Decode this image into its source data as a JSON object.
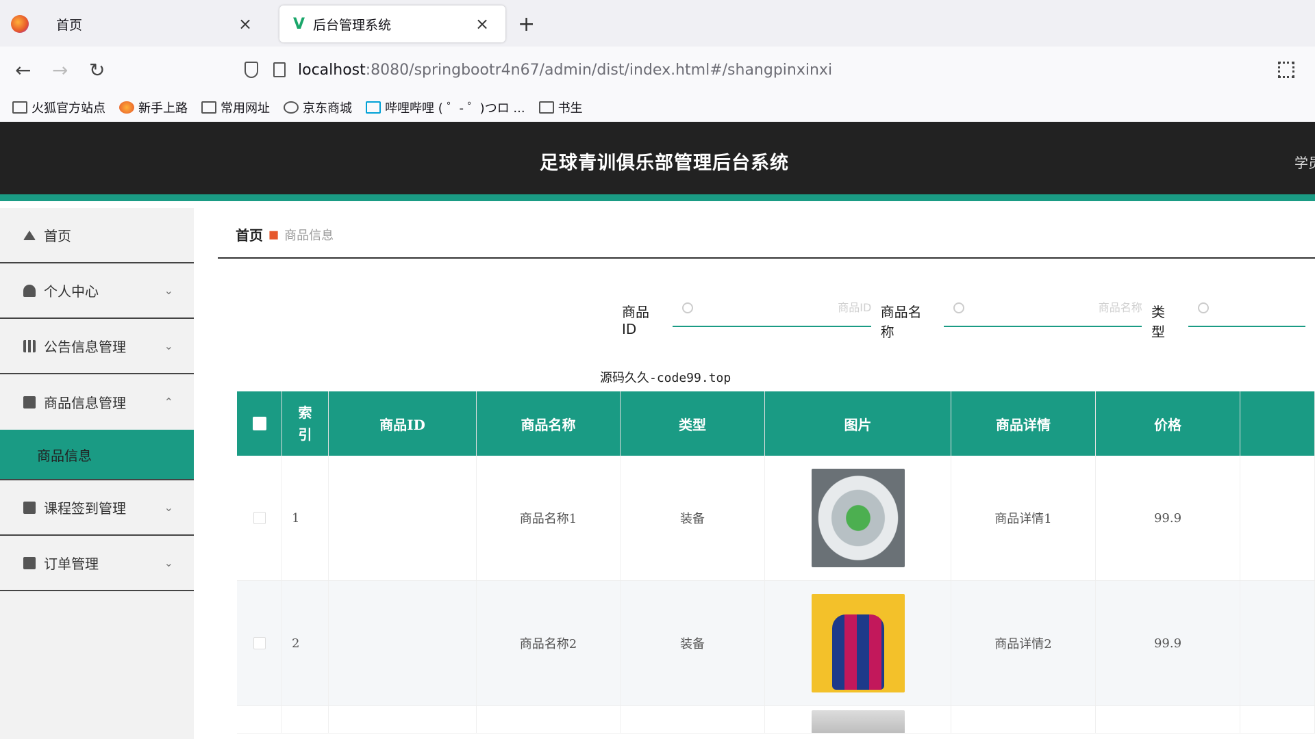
{
  "browser": {
    "tabs": [
      {
        "title": "首页",
        "close": "×"
      },
      {
        "title": "后台管理系统",
        "favicon": "V",
        "close": "×"
      }
    ],
    "new_tab": "+",
    "nav": {
      "back": "←",
      "forward": "→",
      "reload": "↻"
    },
    "url_host": "localhost",
    "url_rest": ":8080/springbootr4n67/admin/dist/index.html#/shangpinxinxi",
    "bookmarks": [
      "火狐官方站点",
      "新手上路",
      "常用网址",
      "京东商城",
      "哔哩哔哩 ( ゜- ゜)つロ ...",
      "书生"
    ]
  },
  "header": {
    "title": "足球青训俱乐部管理后台系统",
    "user": "学员"
  },
  "sidebar": {
    "items": [
      {
        "label": "首页",
        "chevron": ""
      },
      {
        "label": "个人中心",
        "chevron": "⌄"
      },
      {
        "label": "公告信息管理",
        "chevron": "⌄"
      },
      {
        "label": "商品信息管理",
        "chevron": "⌃"
      },
      {
        "label": "课程签到管理",
        "chevron": "⌄"
      },
      {
        "label": "订单管理",
        "chevron": "⌄"
      }
    ],
    "active_sub": "商品信息"
  },
  "breadcrumb": {
    "home": "首页",
    "current": "商品信息"
  },
  "search": {
    "fields": [
      {
        "label": "商品ID",
        "placeholder": "商品ID"
      },
      {
        "label": "商品名称",
        "placeholder": "商品名称"
      },
      {
        "label": "类型",
        "placeholder": ""
      }
    ]
  },
  "source_note": "源码久久-code99.top",
  "table": {
    "headers": [
      "索引",
      "商品ID",
      "商品名称",
      "类型",
      "图片",
      "商品详情",
      "价格"
    ],
    "rows": [
      {
        "index": "1",
        "id": "",
        "name": "商品名称1",
        "type": "装备",
        "image": "stadium",
        "detail": "商品详情1",
        "price": "99.9"
      },
      {
        "index": "2",
        "id": "",
        "name": "商品名称2",
        "type": "装备",
        "image": "backpack",
        "detail": "商品详情2",
        "price": "99.9"
      }
    ]
  },
  "colors": {
    "accent": "#1a9b84",
    "header_bg": "#222222"
  }
}
